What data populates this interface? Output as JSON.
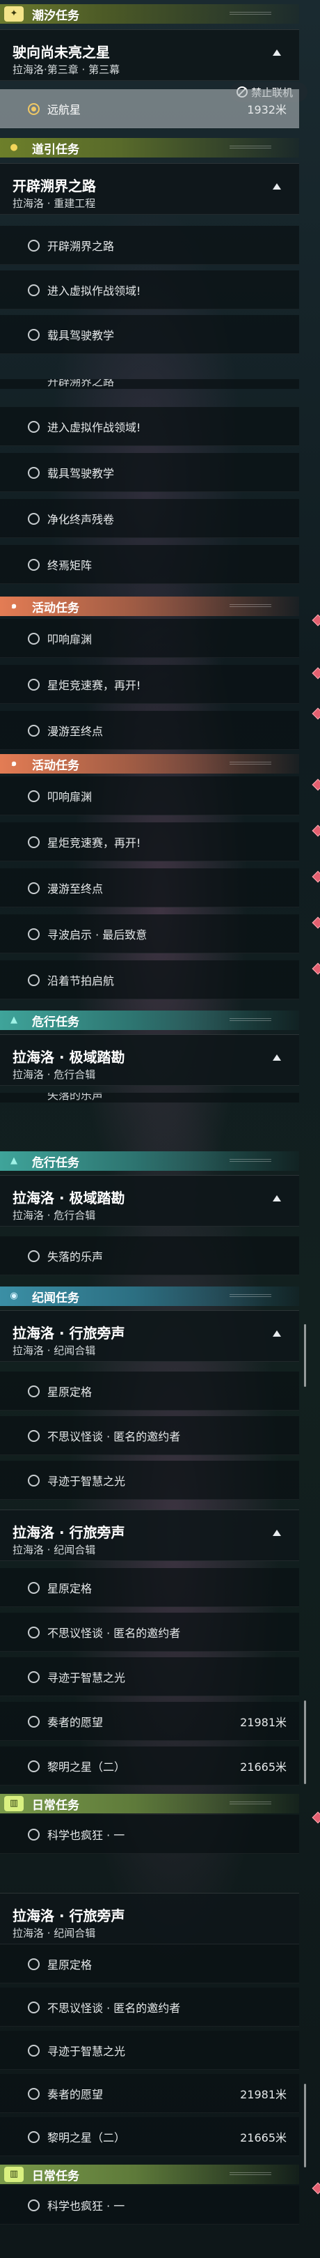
{
  "sections": {
    "tide": {
      "label": "潮汐任务",
      "quest_title": "驶向尚未亮之星",
      "quest_sub": "拉海洛·第三章 · 第三幕",
      "step": "远航星",
      "step_distance": "1932米"
    },
    "banner": {
      "label": "禁止联机"
    },
    "guide": {
      "label": "道引任务",
      "quest_title": "开辟溯界之路",
      "quest_sub": "拉海洛 · 重建工程",
      "steps": [
        "开辟溯界之路",
        "进入虚拟作战领域!",
        "载具驾驶教学",
        "净化终声残卷",
        "终焉矩阵"
      ]
    },
    "activity": {
      "label": "活动任务",
      "steps": [
        "叩响扉渊",
        "星炬竞速赛，再开!",
        "漫游至终点",
        "寻波启示 · 最后致意",
        "沿着节拍启航"
      ]
    },
    "danger": {
      "label": "危行任务",
      "quest_title": "拉海洛 · 极域踏勘",
      "quest_sub": "拉海洛 · 危行合辑",
      "steps": [
        "失落的乐声"
      ]
    },
    "story": {
      "label": "纪闻任务",
      "quest_title": "拉海洛 · 行旅旁声",
      "quest_sub": "拉海洛 · 纪闻合辑",
      "steps": [
        "星原定格",
        "不思议怪谈 · 匿名的邀约者",
        "寻迹于智慧之光",
        "奏者的愿望",
        "黎明之星（二）"
      ],
      "distances": [
        "21981米",
        "21665米"
      ]
    },
    "daily": {
      "label": "日常任务",
      "steps": [
        "科学也疯狂 · 一"
      ]
    }
  },
  "icons": {
    "tide": "plus-star-icon",
    "guide": "location-pin-icon",
    "activity": "spiral-icon",
    "danger": "triangle-warning-icon",
    "story": "eye-icon",
    "daily": "book-icon"
  },
  "colors": {
    "tide_header": "#6b7a2e",
    "activity_header": "#e37c54",
    "danger_header": "#3fa49a",
    "story_header": "#3b8fa5",
    "daily_header": "#7a9a4a",
    "selected_radio": "#f0c865",
    "diamond": "#e46070"
  }
}
